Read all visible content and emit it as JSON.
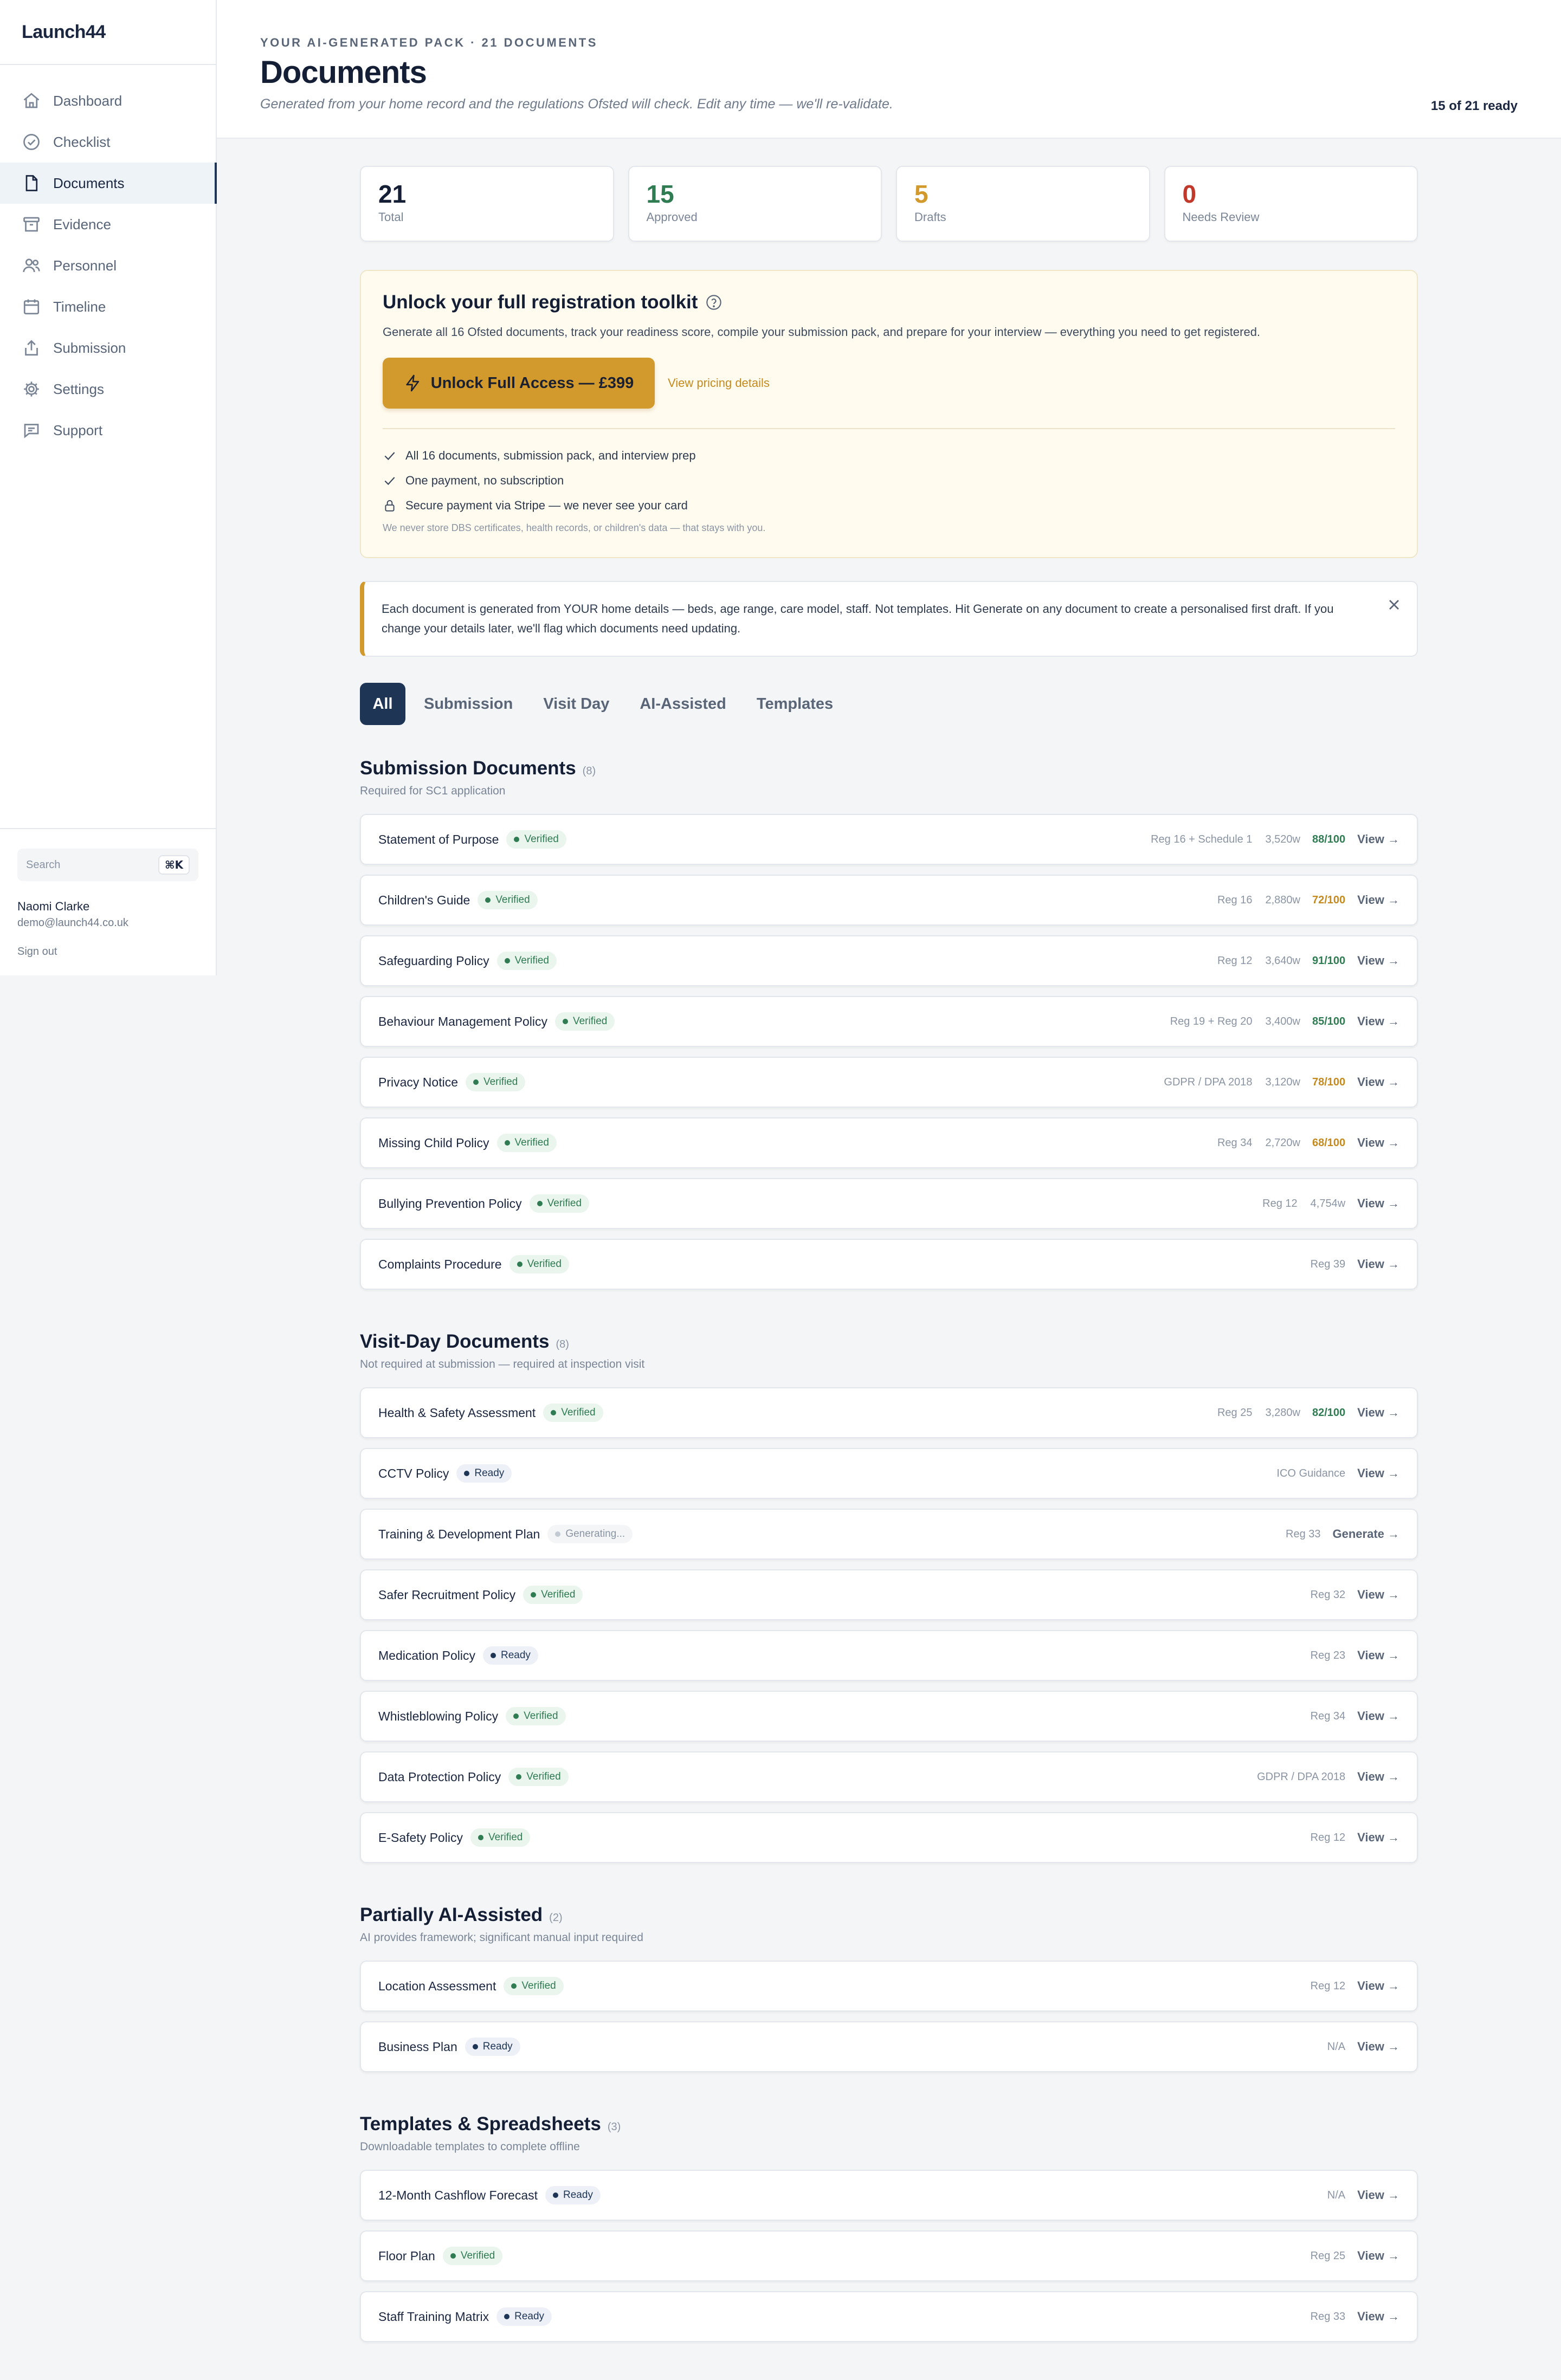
{
  "app": {
    "name": "Launch44"
  },
  "sidebar": {
    "items": [
      {
        "label": "Dashboard",
        "icon": "home-icon"
      },
      {
        "label": "Checklist",
        "icon": "check-circle-icon"
      },
      {
        "label": "Documents",
        "icon": "document-icon"
      },
      {
        "label": "Evidence",
        "icon": "archive-icon"
      },
      {
        "label": "Personnel",
        "icon": "users-icon"
      },
      {
        "label": "Timeline",
        "icon": "calendar-icon"
      },
      {
        "label": "Submission",
        "icon": "upload-icon"
      },
      {
        "label": "Settings",
        "icon": "gear-icon"
      },
      {
        "label": "Support",
        "icon": "chat-icon"
      }
    ],
    "active": "Documents",
    "search_placeholder": "Search",
    "search_shortcut": "⌘K",
    "user_name": "Naomi Clarke",
    "user_email": "demo@launch44.co.uk",
    "sign_out": "Sign out"
  },
  "header": {
    "eyebrow": "YOUR AI-GENERATED PACK · 21 DOCUMENTS",
    "title": "Documents",
    "subtitle": "Generated from your home record and the regulations Ofsted will check. Edit any time — we'll re-validate.",
    "ready": "15 of 21 ready"
  },
  "stats": [
    {
      "value": "21",
      "label": "Total",
      "color": "#141f36"
    },
    {
      "value": "15",
      "label": "Approved",
      "color": "#2f7b52"
    },
    {
      "value": "5",
      "label": "Drafts",
      "color": "#d29a2c"
    },
    {
      "value": "0",
      "label": "Needs Review",
      "color": "#c0392b"
    }
  ],
  "unlock": {
    "title": "Unlock your full registration toolkit",
    "description": "Generate all 16 Ofsted documents, track your readiness score, compile your submission pack, and prepare for your interview — everything you need to get registered.",
    "cta": "Unlock Full Access — £399",
    "pricing_link": "View pricing details",
    "benefits": [
      "All 16 documents, submission pack, and interview prep",
      "One payment, no subscription",
      "Secure payment via Stripe — we never see your card"
    ],
    "fine_print": "We never store DBS certificates, health records, or children's data — that stays with you."
  },
  "notice": {
    "text": "Each document is generated from YOUR home details — beds, age range, care model, staff. Not templates. Hit Generate on any document to create a personalised first draft. If you change your details later, we'll flag which documents need updating."
  },
  "tabs": [
    "All",
    "Submission",
    "Visit Day",
    "AI-Assisted",
    "Templates"
  ],
  "colors": {
    "accent": "#d29a2c",
    "navy": "#1e3556",
    "score_green": "#2f7b52",
    "score_amber": "#c48a1e"
  },
  "sections": [
    {
      "title": "Submission Documents",
      "count": "(8)",
      "subtitle": "Required for SC1 application",
      "docs": [
        {
          "name": "Statement of Purpose",
          "status": "Verified",
          "reg": "Reg 16 + Schedule 1",
          "words": "3,520w",
          "score": "88/100",
          "score_color": "#2f7b52",
          "action": "View →"
        },
        {
          "name": "Children's Guide",
          "status": "Verified",
          "reg": "Reg 16",
          "words": "2,880w",
          "score": "72/100",
          "score_color": "#c48a1e",
          "action": "View →"
        },
        {
          "name": "Safeguarding Policy",
          "status": "Verified",
          "reg": "Reg 12",
          "words": "3,640w",
          "score": "91/100",
          "score_color": "#2f7b52",
          "action": "View →"
        },
        {
          "name": "Behaviour Management Policy",
          "status": "Verified",
          "reg": "Reg 19 + Reg 20",
          "words": "3,400w",
          "score": "85/100",
          "score_color": "#2f7b52",
          "action": "View →"
        },
        {
          "name": "Privacy Notice",
          "status": "Verified",
          "reg": "GDPR / DPA 2018",
          "words": "3,120w",
          "score": "78/100",
          "score_color": "#c48a1e",
          "action": "View →"
        },
        {
          "name": "Missing Child Policy",
          "status": "Verified",
          "reg": "Reg 34",
          "words": "2,720w",
          "score": "68/100",
          "score_color": "#c48a1e",
          "action": "View →"
        },
        {
          "name": "Bullying Prevention Policy",
          "status": "Verified",
          "reg": "Reg 12",
          "words": "4,754w",
          "score": "",
          "action": "View →"
        },
        {
          "name": "Complaints Procedure",
          "status": "Verified",
          "reg": "Reg 39",
          "words": "",
          "score": "",
          "action": "View →"
        }
      ]
    },
    {
      "title": "Visit-Day Documents",
      "count": "(8)",
      "subtitle": "Not required at submission — required at inspection visit",
      "docs": [
        {
          "name": "Health & Safety Assessment",
          "status": "Verified",
          "reg": "Reg 25",
          "words": "3,280w",
          "score": "82/100",
          "score_color": "#2f7b52",
          "action": "View →"
        },
        {
          "name": "CCTV Policy",
          "status": "Ready",
          "reg": "ICO Guidance",
          "words": "",
          "score": "",
          "action": "View →"
        },
        {
          "name": "Training & Development Plan",
          "status": "Generating...",
          "reg": "Reg 33",
          "words": "",
          "score": "",
          "action": "Generate →"
        },
        {
          "name": "Safer Recruitment Policy",
          "status": "Verified",
          "reg": "Reg 32",
          "words": "",
          "score": "",
          "action": "View →"
        },
        {
          "name": "Medication Policy",
          "status": "Ready",
          "reg": "Reg 23",
          "words": "",
          "score": "",
          "action": "View →"
        },
        {
          "name": "Whistleblowing Policy",
          "status": "Verified",
          "reg": "Reg 34",
          "words": "",
          "score": "",
          "action": "View →"
        },
        {
          "name": "Data Protection Policy",
          "status": "Verified",
          "reg": "GDPR / DPA 2018",
          "words": "",
          "score": "",
          "action": "View →"
        },
        {
          "name": "E-Safety Policy",
          "status": "Verified",
          "reg": "Reg 12",
          "words": "",
          "score": "",
          "action": "View →"
        }
      ]
    },
    {
      "title": "Partially AI-Assisted",
      "count": "(2)",
      "subtitle": "AI provides framework; significant manual input required",
      "docs": [
        {
          "name": "Location Assessment",
          "status": "Verified",
          "reg": "Reg 12",
          "words": "",
          "score": "",
          "action": "View →"
        },
        {
          "name": "Business Plan",
          "status": "Ready",
          "reg": "N/A",
          "words": "",
          "score": "",
          "action": "View →"
        }
      ]
    },
    {
      "title": "Templates & Spreadsheets",
      "count": "(3)",
      "subtitle": "Downloadable templates to complete offline",
      "docs": [
        {
          "name": "12-Month Cashflow Forecast",
          "status": "Ready",
          "reg": "N/A",
          "words": "",
          "score": "",
          "action": "View →"
        },
        {
          "name": "Floor Plan",
          "status": "Verified",
          "reg": "Reg 25",
          "words": "",
          "score": "",
          "action": "View →"
        },
        {
          "name": "Staff Training Matrix",
          "status": "Ready",
          "reg": "Reg 33",
          "words": "",
          "score": "",
          "action": "View →"
        }
      ]
    }
  ]
}
